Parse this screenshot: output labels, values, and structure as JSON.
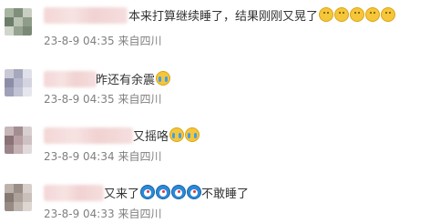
{
  "comments": [
    {
      "text_visible": "本来打算继续睡了，结果刚刚又晃了",
      "emojis": [
        "smile-face-icon",
        "smile-face-icon",
        "smile-face-icon",
        "smile-face-icon",
        "smile-face-icon"
      ],
      "time": "23-8-9 04:35",
      "location": "来自四川"
    },
    {
      "text_visible": "昨还有余震",
      "emojis": [
        "crying-face-icon"
      ],
      "time": "23-8-9 04:35",
      "location": "来自四川"
    },
    {
      "text_visible": "又摇咯",
      "emojis": [
        "crying-face-icon",
        "crying-face-icon"
      ],
      "time": "23-8-9 04:34",
      "location": "来自四川"
    },
    {
      "text_visible": "又来了",
      "emojis": [
        "doraemon-icon",
        "doraemon-icon",
        "doraemon-icon",
        "doraemon-icon"
      ],
      "text_after": "不敢睡了",
      "time": "23-8-9 04:33",
      "location": "来自四川"
    }
  ],
  "colors": {
    "text": "#333333",
    "meta": "#808080",
    "blur": "#f4d6d6"
  }
}
